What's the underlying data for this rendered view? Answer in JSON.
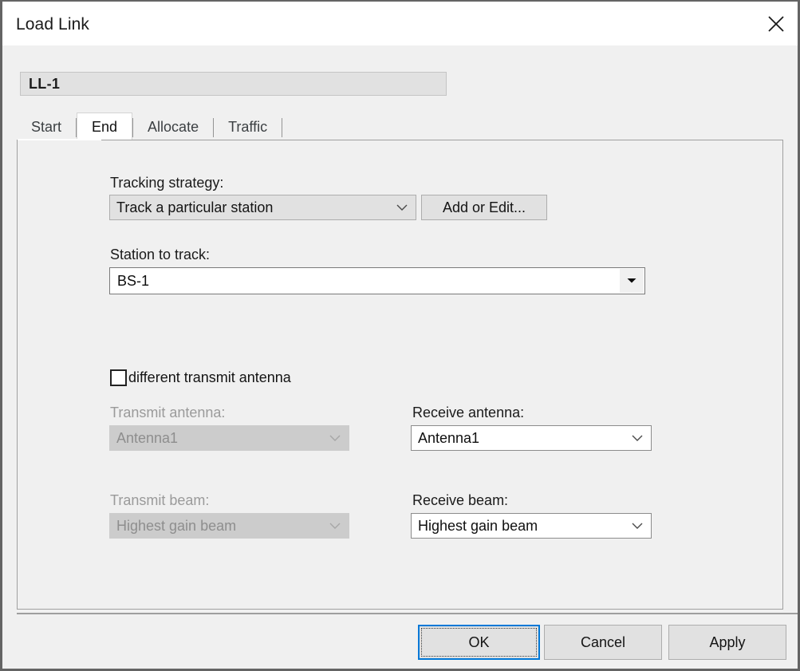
{
  "window": {
    "title": "Load Link",
    "close_icon": "close-icon"
  },
  "name_field": {
    "value": "LL-1"
  },
  "tabs": [
    {
      "label": "Start",
      "selected": false
    },
    {
      "label": "End",
      "selected": true
    },
    {
      "label": "Allocate",
      "selected": false
    },
    {
      "label": "Traffic",
      "selected": false
    }
  ],
  "form": {
    "tracking_strategy": {
      "label": "Tracking strategy:",
      "value": "Track a particular station",
      "chevron_icon": "chevron-down-icon",
      "edit_button_label": "Add or Edit..."
    },
    "station_to_track": {
      "label": "Station to track:",
      "value": "BS-1",
      "arrow_icon": "triangle-down-icon"
    },
    "different_transmit_antenna": {
      "label": "different transmit antenna",
      "checked": false
    },
    "transmit_antenna": {
      "label": "Transmit antenna:",
      "value": "Antenna1",
      "enabled": false,
      "chevron_icon": "chevron-down-icon"
    },
    "receive_antenna": {
      "label": "Receive antenna:",
      "value": "Antenna1",
      "enabled": true,
      "chevron_icon": "chevron-down-icon"
    },
    "transmit_beam": {
      "label": "Transmit beam:",
      "value": "Highest gain beam",
      "enabled": false,
      "chevron_icon": "chevron-down-icon"
    },
    "receive_beam": {
      "label": "Receive beam:",
      "value": "Highest gain beam",
      "enabled": true,
      "chevron_icon": "chevron-down-icon"
    }
  },
  "footer": {
    "ok_label": "OK",
    "cancel_label": "Cancel",
    "apply_label": "Apply"
  },
  "colors": {
    "accent": "#0078d7",
    "window_border": "#646464",
    "dialog_bg": "#f0f0f0",
    "field_gray": "#e1e1e1",
    "disabled_bg": "#cccccc",
    "disabled_text": "#8e8e8e"
  }
}
